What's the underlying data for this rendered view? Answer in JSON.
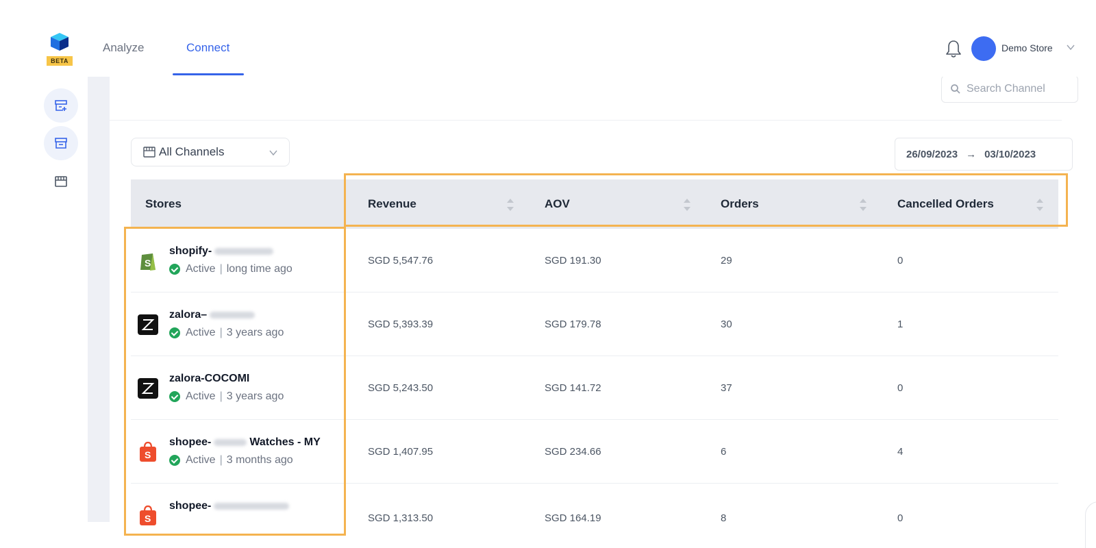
{
  "app": {
    "beta_badge": "BETA"
  },
  "nav": {
    "tabs": [
      {
        "label": "Analyze",
        "active": false
      },
      {
        "label": "Connect",
        "active": true
      }
    ]
  },
  "user": {
    "store_name": "Demo Store"
  },
  "colors": {
    "accent": "#3563e9",
    "highlight": "#f4b350",
    "active_green": "#22a55a"
  },
  "search": {
    "placeholder": "Search Channel"
  },
  "filters": {
    "channel_select": "All Channels",
    "date_start": "26/09/2023",
    "date_arrow": "→",
    "date_end": "03/10/2023"
  },
  "table": {
    "columns": [
      "Stores",
      "Revenue",
      "AOV",
      "Orders",
      "Cancelled Orders"
    ],
    "rows": [
      {
        "store": "shopify-",
        "store_suffix": "",
        "platform": "shopify",
        "status": "Active",
        "updated": "long time ago",
        "revenue": "SGD 5,547.76",
        "aov": "SGD 191.30",
        "orders": "29",
        "cancelled": "0"
      },
      {
        "store": "zalora–",
        "store_suffix": "",
        "platform": "zalora",
        "status": "Active",
        "updated": "3 years ago",
        "revenue": "SGD 5,393.39",
        "aov": "SGD 179.78",
        "orders": "30",
        "cancelled": "1"
      },
      {
        "store": "zalora-COCOMI",
        "store_suffix": "",
        "platform": "zalora",
        "status": "Active",
        "updated": "3 years ago",
        "revenue": "SGD 5,243.50",
        "aov": "SGD 141.72",
        "orders": "37",
        "cancelled": "0"
      },
      {
        "store": "shopee-",
        "store_suffix": "Watches - MY",
        "platform": "shopee",
        "status": "Active",
        "updated": "3 months ago",
        "revenue": "SGD 1,407.95",
        "aov": "SGD 234.66",
        "orders": "6",
        "cancelled": "4"
      },
      {
        "store": "shopee-",
        "store_suffix": "",
        "platform": "shopee",
        "status": "",
        "updated": "",
        "revenue": "SGD 1,313.50",
        "aov": "SGD 164.19",
        "orders": "8",
        "cancelled": "0"
      }
    ]
  }
}
